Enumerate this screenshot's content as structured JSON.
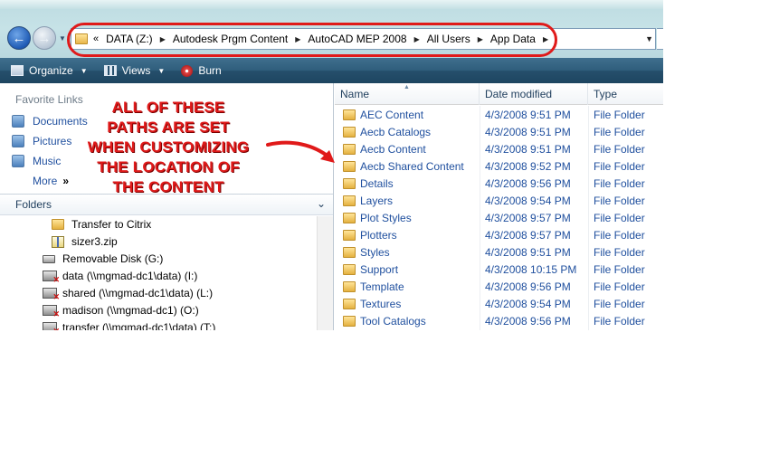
{
  "address_bar": {
    "overflow_chevron": "«",
    "crumbs": [
      "DATA (Z:)",
      "Autodesk Prgm Content",
      "AutoCAD MEP 2008",
      "All Users",
      "App Data"
    ]
  },
  "toolbar": {
    "organize": "Organize",
    "views": "Views",
    "burn": "Burn"
  },
  "favorite_links": {
    "title": "Favorite Links",
    "items": [
      "Documents",
      "Pictures",
      "Music"
    ],
    "more": "More",
    "more_glyph": "»"
  },
  "folders_header": {
    "label": "Folders",
    "chevron": "⌄"
  },
  "tree": [
    {
      "label": "Transfer to Citrix",
      "icon": "folder-icon"
    },
    {
      "label": "sizer3.zip",
      "icon": "zip-icon"
    },
    {
      "label": "Removable Disk (G:)",
      "icon": "removable-disk-icon"
    },
    {
      "label": "data (\\\\mgmad-dc1\\data) (I:)",
      "icon": "disconnected-drive-icon"
    },
    {
      "label": "shared (\\\\mgmad-dc1\\data) (L:)",
      "icon": "disconnected-drive-icon"
    },
    {
      "label": "madison (\\\\mgmad-dc1) (O:)",
      "icon": "disconnected-drive-icon"
    },
    {
      "label": "transfer (\\\\mgmad-dc1\\data) (T:)",
      "icon": "disconnected-drive-icon"
    }
  ],
  "annotation": {
    "lines": [
      "ALL OF THESE",
      "PATHS ARE SET",
      "WHEN CUSTOMIZING",
      "THE LOCATION OF",
      "THE CONTENT"
    ],
    "color": "#e01a1a"
  },
  "file_list": {
    "columns": [
      "Name",
      "Date modified",
      "Type"
    ],
    "rows": [
      {
        "name": "AEC Content",
        "date": "4/3/2008 9:51 PM",
        "type": "File Folder"
      },
      {
        "name": "Aecb Catalogs",
        "date": "4/3/2008 9:51 PM",
        "type": "File Folder"
      },
      {
        "name": "Aecb Content",
        "date": "4/3/2008 9:51 PM",
        "type": "File Folder"
      },
      {
        "name": "Aecb Shared Content",
        "date": "4/3/2008 9:52 PM",
        "type": "File Folder"
      },
      {
        "name": "Details",
        "date": "4/3/2008 9:56 PM",
        "type": "File Folder"
      },
      {
        "name": "Layers",
        "date": "4/3/2008 9:54 PM",
        "type": "File Folder"
      },
      {
        "name": "Plot Styles",
        "date": "4/3/2008 9:57 PM",
        "type": "File Folder"
      },
      {
        "name": "Plotters",
        "date": "4/3/2008 9:57 PM",
        "type": "File Folder"
      },
      {
        "name": "Styles",
        "date": "4/3/2008 9:51 PM",
        "type": "File Folder"
      },
      {
        "name": "Support",
        "date": "4/3/2008 10:15 PM",
        "type": "File Folder"
      },
      {
        "name": "Template",
        "date": "4/3/2008 9:56 PM",
        "type": "File Folder"
      },
      {
        "name": "Textures",
        "date": "4/3/2008 9:54 PM",
        "type": "File Folder"
      },
      {
        "name": "Tool Catalogs",
        "date": "4/3/2008 9:56 PM",
        "type": "File Folder"
      }
    ]
  },
  "colors": {
    "link_blue": "#1f4f9e",
    "toolbar_dark": "#264f6c",
    "highlight_red": "#e01a1a"
  }
}
